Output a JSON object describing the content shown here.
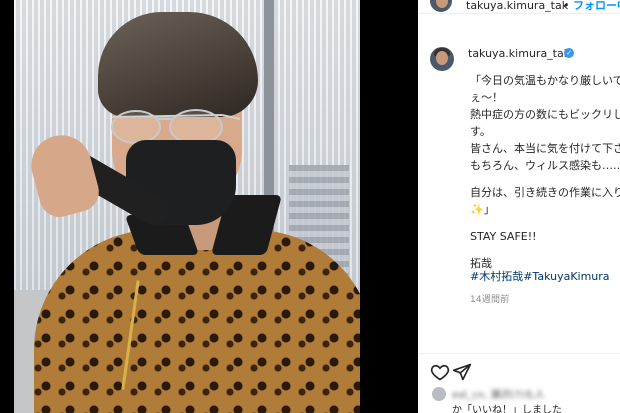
{
  "header": {
    "username": "takuya.kimura_tak",
    "separator": "•",
    "follow_label": "フォロー中"
  },
  "post": {
    "username": "takuya.kimura_tak",
    "verified_icon": "verified-badge-icon",
    "caption_lines": [
      "「今日の気温もかなり厳しいで",
      "ぇ〜！",
      "熱中症の方の数にもビックリし",
      "す。",
      "皆さん、本当に気を付けて下さ",
      "もちろん、ウィルス感染も……。",
      "",
      "自分は、引き続きの作業に入り",
      "✨」",
      "",
      "STAY SAFE!!",
      "",
      "拓哉"
    ],
    "hashtags": "#木村拓哉#TakuyaKimura",
    "timestamp": "14週間前"
  },
  "actions": {
    "like_icon": "heart-icon",
    "share_icon": "send-icon"
  },
  "likes": {
    "blurred_names": "est_cn, 瀬沢(7)も人",
    "suffix": "か「いいね！」しました"
  },
  "colors": {
    "link_blue": "#0095f6",
    "hashtag_blue": "#00376b",
    "verified_blue": "#3897f0",
    "text_primary": "#262626",
    "text_secondary": "#8e8e8e"
  }
}
